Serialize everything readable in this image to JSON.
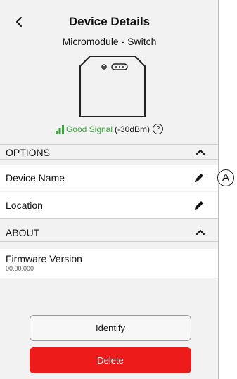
{
  "header": {
    "title": "Device Details",
    "subtitle": "Micromodule - Switch"
  },
  "signal": {
    "quality_label": "Good Signal",
    "strength": "(-30dBm)",
    "help_glyph": "?",
    "color": "#3aa53a"
  },
  "options_section": {
    "label": "OPTIONS",
    "rows": [
      {
        "label": "Device Name"
      },
      {
        "label": "Location"
      }
    ]
  },
  "about_section": {
    "label": "ABOUT",
    "firmware_label": "Firmware Version",
    "firmware_value": "00.00.000"
  },
  "callout": {
    "label": "A"
  },
  "buttons": {
    "identify_label": "Identify",
    "delete_label": "Delete",
    "delete_color": "#ee1b1b"
  },
  "icons": [
    "back-chevron-icon",
    "signal-bars-icon",
    "help-icon",
    "chevron-up-icon",
    "pencil-icon"
  ]
}
